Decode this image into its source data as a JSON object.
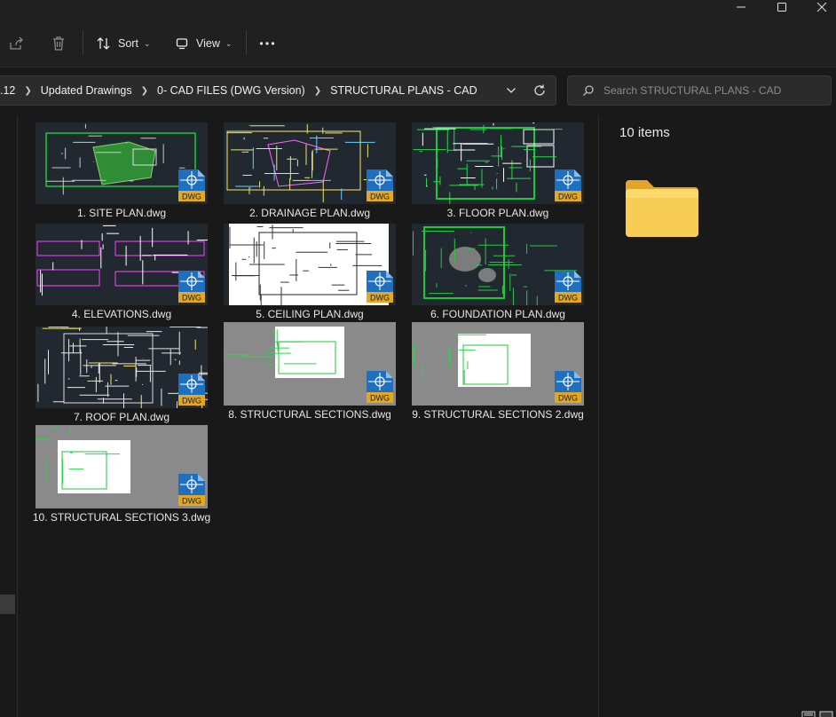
{
  "window": {
    "controls": [
      "minimize-icon",
      "maximize-icon",
      "close-icon"
    ]
  },
  "toolbar": {
    "share_icon": "share-icon",
    "delete_icon": "trash-icon",
    "sort_label": "Sort",
    "view_label": "View",
    "more_icon": "more-icon"
  },
  "address": {
    "crumbs": [
      ".12",
      "Updated Drawings",
      "0- CAD FILES (DWG Version)",
      "STRUCTURAL PLANS - CAD"
    ]
  },
  "search": {
    "placeholder": "Search STRUCTURAL PLANS - CAD"
  },
  "files": [
    {
      "name": "1. SITE PLAN.dwg",
      "style": "site"
    },
    {
      "name": "2. DRAINAGE PLAN.dwg",
      "style": "drain"
    },
    {
      "name": "3. FLOOR PLAN.dwg",
      "style": "floor"
    },
    {
      "name": "4. ELEVATIONS.dwg",
      "style": "elev"
    },
    {
      "name": "5. CEILING PLAN.dwg",
      "style": "ceiling"
    },
    {
      "name": "6. FOUNDATION PLAN.dwg",
      "style": "found"
    },
    {
      "name": "7. ROOF PLAN.dwg",
      "style": "roof"
    },
    {
      "name": "8. STRUCTURAL SECTIONS.dwg",
      "style": "sheet"
    },
    {
      "name": "9. STRUCTURAL SECTIONS 2.dwg",
      "style": "sheet"
    },
    {
      "name": "10. STRUCTURAL SECTIONS 3.dwg",
      "style": "sheet"
    }
  ],
  "badge_text": "DWG",
  "details": {
    "count": "10 items"
  },
  "colors": {
    "background": "#191919",
    "toolbar": "#202020",
    "cad_dark": "#212830",
    "cad_green": "#21c63a",
    "folder": "#f6c342"
  }
}
